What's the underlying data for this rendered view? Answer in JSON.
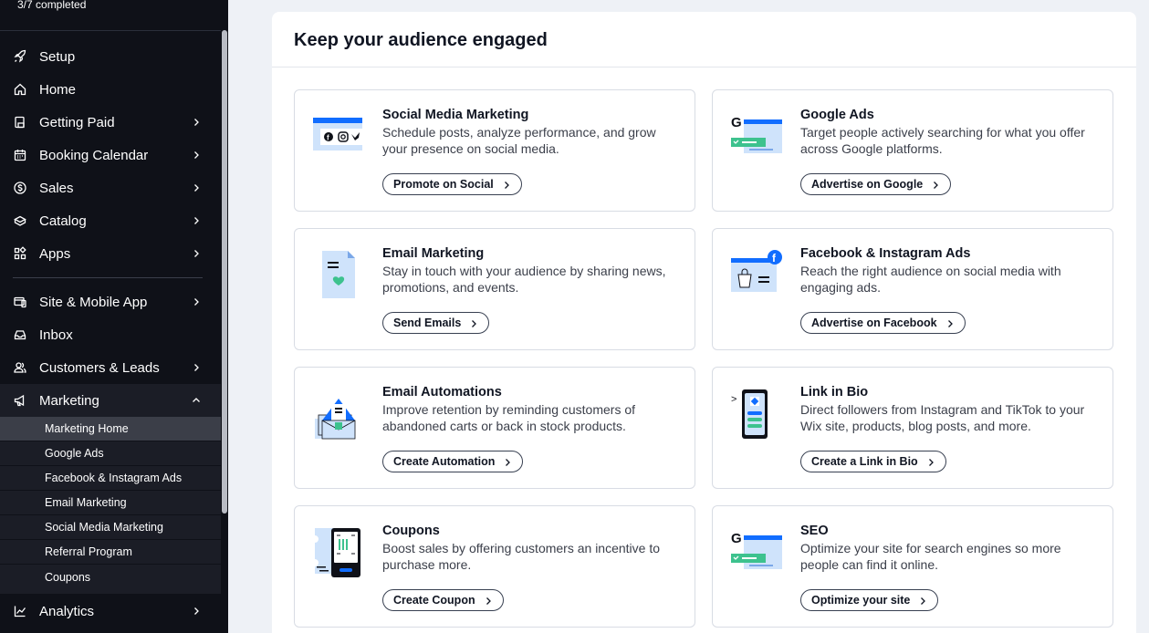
{
  "progress": {
    "text": "3/7 completed"
  },
  "sidebar": {
    "items": [
      {
        "label": "Setup",
        "icon": "rocket-icon",
        "chevron": false
      },
      {
        "label": "Home",
        "icon": "home-icon",
        "chevron": false
      },
      {
        "label": "Getting Paid",
        "icon": "getting-paid-icon",
        "chevron": true
      },
      {
        "label": "Booking Calendar",
        "icon": "calendar-icon",
        "chevron": true
      },
      {
        "label": "Sales",
        "icon": "dollar-icon",
        "chevron": true
      },
      {
        "label": "Catalog",
        "icon": "catalog-icon",
        "chevron": true
      },
      {
        "label": "Apps",
        "icon": "apps-icon",
        "chevron": true
      },
      {
        "label": "Site & Mobile App",
        "icon": "site-icon",
        "chevron": true
      },
      {
        "label": "Inbox",
        "icon": "inbox-icon",
        "chevron": false
      },
      {
        "label": "Customers & Leads",
        "icon": "customers-icon",
        "chevron": true
      },
      {
        "label": "Marketing",
        "icon": "megaphone-icon",
        "chevron": "up"
      },
      {
        "label": "Analytics",
        "icon": "analytics-icon",
        "chevron": true
      }
    ],
    "marketing_sub": [
      {
        "label": "Marketing Home",
        "selected": true
      },
      {
        "label": "Google Ads"
      },
      {
        "label": "Facebook & Instagram Ads"
      },
      {
        "label": "Email Marketing"
      },
      {
        "label": "Social Media Marketing"
      },
      {
        "label": "Referral Program"
      },
      {
        "label": "Coupons"
      }
    ]
  },
  "main": {
    "title": "Keep your audience engaged",
    "cards": [
      {
        "title": "Social Media Marketing",
        "desc": "Schedule posts, analyze performance, and grow your presence on social media.",
        "button": "Promote on Social",
        "icon": "social-media-illustration-icon"
      },
      {
        "title": "Google Ads",
        "desc": "Target people actively searching for what you offer across Google platforms.",
        "button": "Advertise on Google",
        "icon": "google-ads-illustration-icon"
      },
      {
        "title": "Email Marketing",
        "desc": "Stay in touch with your audience by sharing news, promotions, and events.",
        "button": "Send Emails",
        "icon": "email-marketing-illustration-icon"
      },
      {
        "title": "Facebook & Instagram Ads",
        "desc": "Reach the right audience on social media with engaging ads.",
        "button": "Advertise on Facebook",
        "icon": "facebook-ads-illustration-icon"
      },
      {
        "title": "Email Automations",
        "desc": "Improve retention by reminding customers of abandoned carts or back in stock products.",
        "button": "Create Automation",
        "icon": "email-automation-illustration-icon"
      },
      {
        "title": "Link in Bio",
        "desc": "Direct followers from Instagram and TikTok to your Wix site, products, blog posts, and more.",
        "button": "Create a Link in Bio",
        "icon": "link-in-bio-illustration-icon"
      },
      {
        "title": "Coupons",
        "desc": "Boost sales by offering customers an incentive to purchase more.",
        "button": "Create Coupon",
        "icon": "coupon-illustration-icon"
      },
      {
        "title": "SEO",
        "desc": "Optimize your site for search engines so more people can find it online.",
        "button": "Optimize your site",
        "icon": "seo-illustration-icon"
      }
    ]
  },
  "colors": {
    "sidebar_bg": "#0f1118",
    "selected_bg": "#3b3e48",
    "accent_blue": "#116dff",
    "light_blue": "#cfe3fb",
    "green": "#3dc28e"
  }
}
